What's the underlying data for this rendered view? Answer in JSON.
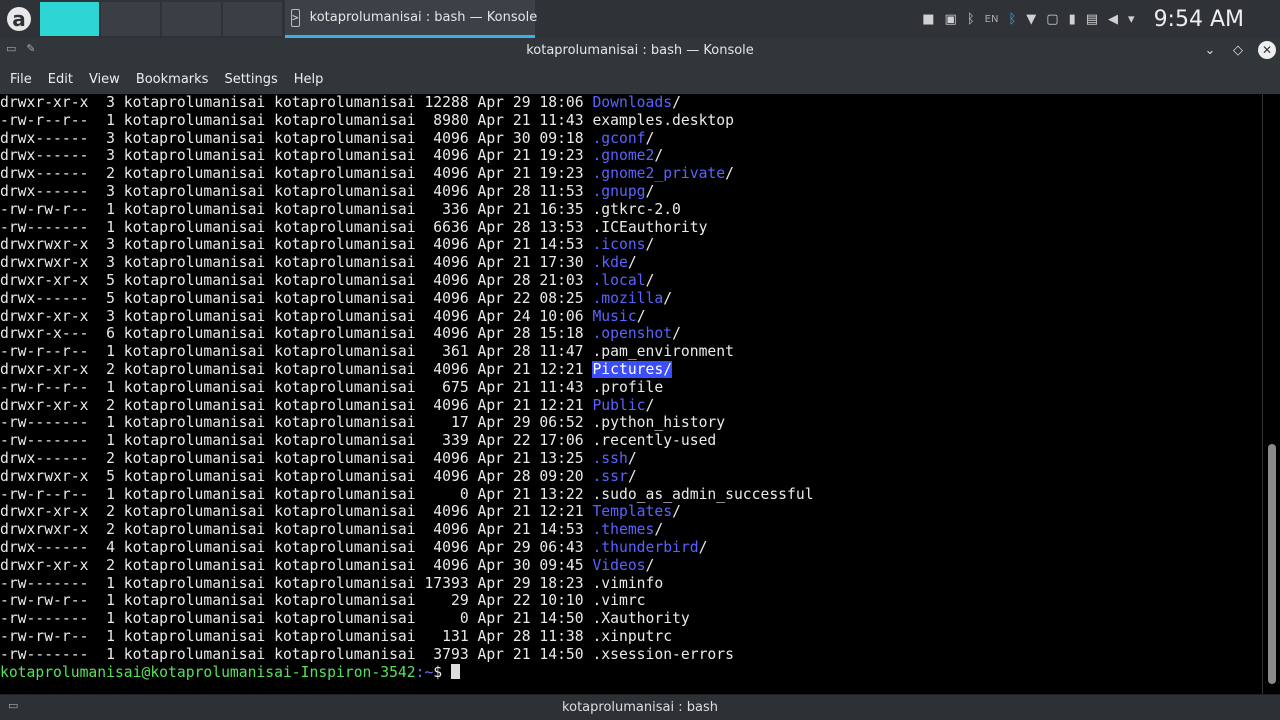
{
  "panel": {
    "launcher_glyph": "a",
    "task_title": "kotaprolumanisai : bash — Konsole",
    "tray": {
      "keyboard_layout": "EN",
      "clock": "9:54 AM"
    }
  },
  "window": {
    "title": "kotaprolumanisai : bash — Konsole"
  },
  "menu": [
    "File",
    "Edit",
    "View",
    "Bookmarks",
    "Settings",
    "Help"
  ],
  "terminal": {
    "lines": [
      {
        "text": "drwxr-xr-x  3 kotaprolumanisai kotaprolumanisai 12288 Apr 29 18:06 ",
        "name": "Downloads",
        "suffix": "/",
        "dir": true
      },
      {
        "text": "-rw-r--r--  1 kotaprolumanisai kotaprolumanisai  8980 Apr 21 11:43 ",
        "name": "examples.desktop",
        "suffix": "",
        "dir": false
      },
      {
        "text": "drwx------  3 kotaprolumanisai kotaprolumanisai  4096 Apr 30 09:18 ",
        "name": ".gconf",
        "suffix": "/",
        "dir": true
      },
      {
        "text": "drwx------  3 kotaprolumanisai kotaprolumanisai  4096 Apr 21 19:23 ",
        "name": ".gnome2",
        "suffix": "/",
        "dir": true
      },
      {
        "text": "drwx------  2 kotaprolumanisai kotaprolumanisai  4096 Apr 21 19:23 ",
        "name": ".gnome2_private",
        "suffix": "/",
        "dir": true
      },
      {
        "text": "drwx------  3 kotaprolumanisai kotaprolumanisai  4096 Apr 28 11:53 ",
        "name": ".gnupg",
        "suffix": "/",
        "dir": true
      },
      {
        "text": "-rw-rw-r--  1 kotaprolumanisai kotaprolumanisai   336 Apr 21 16:35 ",
        "name": ".gtkrc-2.0",
        "suffix": "",
        "dir": false
      },
      {
        "text": "-rw-------  1 kotaprolumanisai kotaprolumanisai  6636 Apr 28 13:53 ",
        "name": ".ICEauthority",
        "suffix": "",
        "dir": false
      },
      {
        "text": "drwxrwxr-x  3 kotaprolumanisai kotaprolumanisai  4096 Apr 21 14:53 ",
        "name": ".icons",
        "suffix": "/",
        "dir": true
      },
      {
        "text": "drwxrwxr-x  3 kotaprolumanisai kotaprolumanisai  4096 Apr 21 17:30 ",
        "name": ".kde",
        "suffix": "/",
        "dir": true
      },
      {
        "text": "drwxr-xr-x  5 kotaprolumanisai kotaprolumanisai  4096 Apr 28 21:03 ",
        "name": ".local",
        "suffix": "/",
        "dir": true
      },
      {
        "text": "drwx------  5 kotaprolumanisai kotaprolumanisai  4096 Apr 22 08:25 ",
        "name": ".mozilla",
        "suffix": "/",
        "dir": true
      },
      {
        "text": "drwxr-xr-x  3 kotaprolumanisai kotaprolumanisai  4096 Apr 24 10:06 ",
        "name": "Music",
        "suffix": "/",
        "dir": true
      },
      {
        "text": "drwxr-x---  6 kotaprolumanisai kotaprolumanisai  4096 Apr 28 15:18 ",
        "name": ".openshot",
        "suffix": "/",
        "dir": true
      },
      {
        "text": "-rw-r--r--  1 kotaprolumanisai kotaprolumanisai   361 Apr 28 11:47 ",
        "name": ".pam_environment",
        "suffix": "",
        "dir": false
      },
      {
        "text": "drwxr-xr-x  2 kotaprolumanisai kotaprolumanisai  4096 Apr 21 12:21 ",
        "name": "Pictures",
        "suffix": "/",
        "dir": true,
        "highlight": true
      },
      {
        "text": "-rw-r--r--  1 kotaprolumanisai kotaprolumanisai   675 Apr 21 11:43 ",
        "name": ".profile",
        "suffix": "",
        "dir": false
      },
      {
        "text": "drwxr-xr-x  2 kotaprolumanisai kotaprolumanisai  4096 Apr 21 12:21 ",
        "name": "Public",
        "suffix": "/",
        "dir": true
      },
      {
        "text": "-rw-------  1 kotaprolumanisai kotaprolumanisai    17 Apr 29 06:52 ",
        "name": ".python_history",
        "suffix": "",
        "dir": false
      },
      {
        "text": "-rw-------  1 kotaprolumanisai kotaprolumanisai   339 Apr 22 17:06 ",
        "name": ".recently-used",
        "suffix": "",
        "dir": false
      },
      {
        "text": "drwx------  2 kotaprolumanisai kotaprolumanisai  4096 Apr 21 13:25 ",
        "name": ".ssh",
        "suffix": "/",
        "dir": true
      },
      {
        "text": "drwxrwxr-x  5 kotaprolumanisai kotaprolumanisai  4096 Apr 28 09:20 ",
        "name": ".ssr",
        "suffix": "/",
        "dir": true
      },
      {
        "text": "-rw-r--r--  1 kotaprolumanisai kotaprolumanisai     0 Apr 21 13:22 ",
        "name": ".sudo_as_admin_successful",
        "suffix": "",
        "dir": false
      },
      {
        "text": "drwxr-xr-x  2 kotaprolumanisai kotaprolumanisai  4096 Apr 21 12:21 ",
        "name": "Templates",
        "suffix": "/",
        "dir": true
      },
      {
        "text": "drwxrwxr-x  2 kotaprolumanisai kotaprolumanisai  4096 Apr 21 14:53 ",
        "name": ".themes",
        "suffix": "/",
        "dir": true
      },
      {
        "text": "drwx------  4 kotaprolumanisai kotaprolumanisai  4096 Apr 29 06:43 ",
        "name": ".thunderbird",
        "suffix": "/",
        "dir": true
      },
      {
        "text": "drwxr-xr-x  2 kotaprolumanisai kotaprolumanisai  4096 Apr 30 09:45 ",
        "name": "Videos",
        "suffix": "/",
        "dir": true
      },
      {
        "text": "-rw-------  1 kotaprolumanisai kotaprolumanisai 17393 Apr 29 18:23 ",
        "name": ".viminfo",
        "suffix": "",
        "dir": false
      },
      {
        "text": "-rw-rw-r--  1 kotaprolumanisai kotaprolumanisai    29 Apr 22 10:10 ",
        "name": ".vimrc",
        "suffix": "",
        "dir": false
      },
      {
        "text": "-rw-------  1 kotaprolumanisai kotaprolumanisai     0 Apr 21 14:50 ",
        "name": ".Xauthority",
        "suffix": "",
        "dir": false
      },
      {
        "text": "-rw-rw-r--  1 kotaprolumanisai kotaprolumanisai   131 Apr 28 11:38 ",
        "name": ".xinputrc",
        "suffix": "",
        "dir": false
      },
      {
        "text": "-rw-------  1 kotaprolumanisai kotaprolumanisai  3793 Apr 21 14:50 ",
        "name": ".xsession-errors",
        "suffix": "",
        "dir": false
      }
    ],
    "prompt": {
      "user_host": "kotaprolumanisai@kotaprolumanisai-Inspiron-3542",
      "path": ":~",
      "symbol": "$ "
    }
  },
  "tab": {
    "label": "kotaprolumanisai : bash"
  },
  "colors": {
    "directory": "#5a63ff",
    "selection": "#3c4dfb",
    "prompt_user": "#55e25a",
    "accent": "#2ed5d5"
  }
}
